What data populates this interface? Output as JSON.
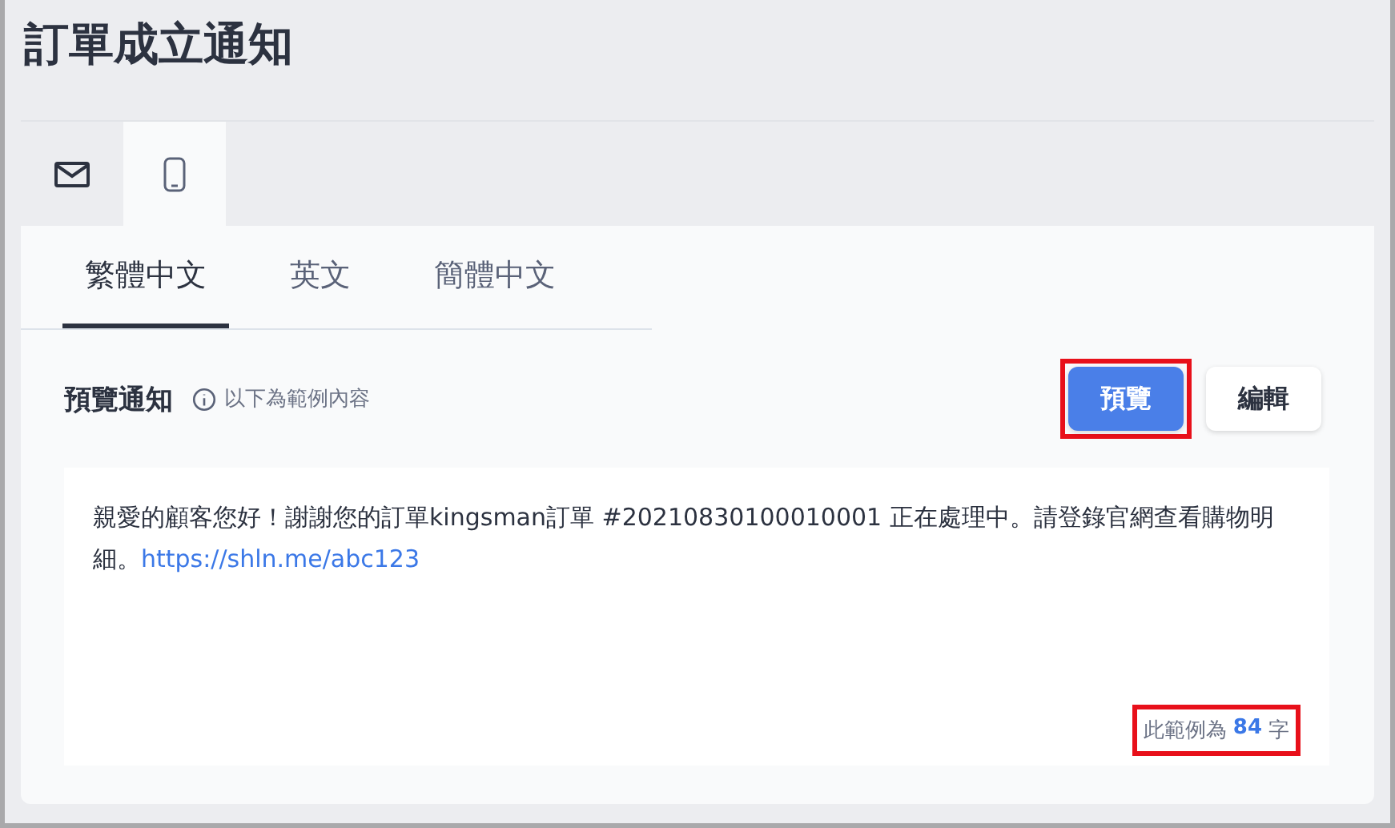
{
  "title": "訂單成立通知",
  "channel_tabs": [
    {
      "kind": "email",
      "selected": false
    },
    {
      "kind": "phone",
      "selected": true
    }
  ],
  "language_tabs": [
    {
      "label": "繁體中文",
      "selected": true
    },
    {
      "label": "英文",
      "selected": false
    },
    {
      "label": "簡體中文",
      "selected": false
    }
  ],
  "preview": {
    "heading": "預覽通知",
    "hint": "以下為範例內容",
    "buttons": [
      {
        "label": "預覽",
        "selected": true,
        "highlighted": true
      },
      {
        "label": "編輯",
        "selected": false,
        "highlighted": false
      }
    ],
    "message": "親愛的顧客您好！謝謝您的訂單kingsman訂單 #20210830100010001 正在處理中。請登錄官網查看購物明細。",
    "link": "https://shln.me/abc123",
    "counter": {
      "prefix": "此範例為",
      "count": "84",
      "suffix": "字",
      "highlighted": true
    }
  }
}
